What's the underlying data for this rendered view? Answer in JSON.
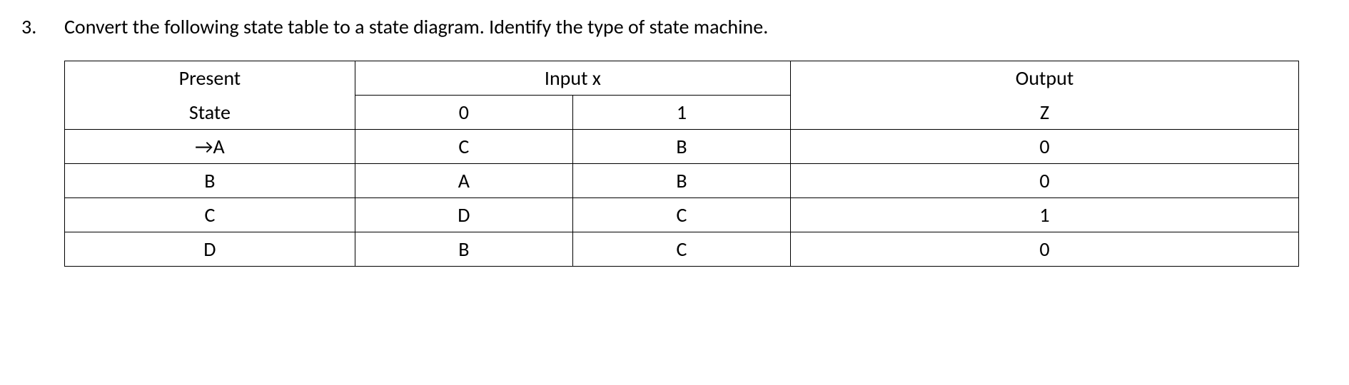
{
  "question": {
    "number": "3.",
    "text": "Convert the following state table to a state diagram. Identify the type of state machine."
  },
  "table": {
    "headers": {
      "present_state_line1": "Present",
      "present_state_line2": "State",
      "input_x": "Input x",
      "input_0": "0",
      "input_1": "1",
      "output": "Output",
      "output_z": "Z"
    },
    "rows": [
      {
        "state": "→A",
        "next0": "C",
        "next1": "B",
        "output": "0"
      },
      {
        "state": "B",
        "next0": "A",
        "next1": "B",
        "output": "0"
      },
      {
        "state": "C",
        "next0": "D",
        "next1": "C",
        "output": "1"
      },
      {
        "state": "D",
        "next0": "B",
        "next1": "C",
        "output": "0"
      }
    ]
  }
}
